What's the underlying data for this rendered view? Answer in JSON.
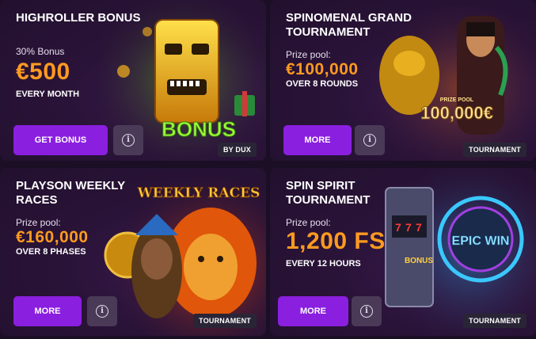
{
  "cards": [
    {
      "title": "HIGHROLLER BONUS",
      "subtitle": "30% Bonus",
      "amount": "€500",
      "period": "EVERY MONTH",
      "button_label": "GET BONUS",
      "info_glyph": "i",
      "badge": "BY DUX",
      "art_text": "BONUS"
    },
    {
      "title": "SPINOMENAL GRAND TOURNAMENT",
      "subtitle": "Prize pool:",
      "amount": "€100,000",
      "period": "OVER 8 ROUNDS",
      "button_label": "MORE",
      "info_glyph": "i",
      "badge": "TOURNAMENT",
      "art_small": "PRIZE POOL",
      "art_text": "100,000€"
    },
    {
      "title": "PLAYSON WEEKLY RACES",
      "subtitle": "Prize pool:",
      "amount": "€160,000",
      "period": "OVER 8 PHASES",
      "button_label": "MORE",
      "info_glyph": "i",
      "badge": "TOURNAMENT",
      "art_text": "WEEKLY RACES"
    },
    {
      "title": "SPIN SPIRIT TOURNAMENT",
      "subtitle": "Prize pool:",
      "amount": "1,200 FS",
      "period": "EVERY 12 HOURS",
      "button_label": "MORE",
      "info_glyph": "i",
      "badge": "TOURNAMENT",
      "art_text": "EPIC WIN",
      "art_small": "BONUS"
    }
  ],
  "colors": {
    "accent": "#8a1fe0",
    "amount": "#ff9a1f",
    "card_bg": "#2a1338"
  }
}
